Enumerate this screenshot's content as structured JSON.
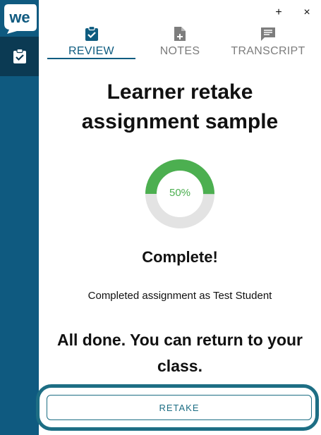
{
  "app": {
    "logo_text": "we",
    "accent": "#0f5a80",
    "accent_dark": "#0b3a53"
  },
  "window": {
    "add_label": "+",
    "close_label": "×"
  },
  "sidebar": {
    "items": [
      {
        "icon": "clipboard-check-icon",
        "active": true
      }
    ]
  },
  "tabs": [
    {
      "label": "REVIEW",
      "icon": "clipboard-check-icon",
      "active": true
    },
    {
      "label": "NOTES",
      "icon": "note-add-icon",
      "active": false
    },
    {
      "label": "TRANSCRIPT",
      "icon": "chat-transcript-icon",
      "active": false
    }
  ],
  "main": {
    "title_line1": "Learner retake",
    "title_line2": "assignment sample",
    "progress": {
      "percent": 50,
      "label": "50%",
      "color": "#4caf50",
      "track_color": "#e3e3e3"
    },
    "status": "Complete!",
    "completed_by": "Completed assignment as Test Student",
    "message_line1": "All done. You can return to your",
    "message_line2": "class.",
    "retake_label": "RETAKE"
  }
}
